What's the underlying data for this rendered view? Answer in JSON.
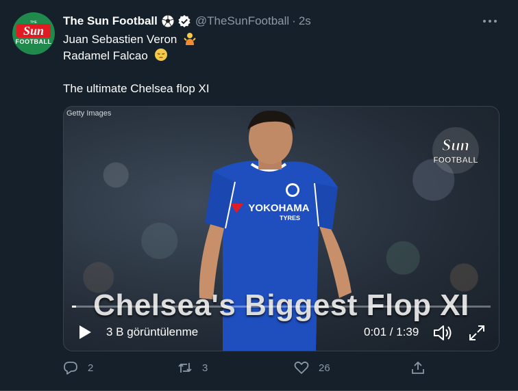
{
  "tweet": {
    "account": {
      "display_name": "The Sun Football",
      "handle": "@TheSunFootball",
      "separator": "·",
      "time": "2s",
      "avatar_logo": {
        "the": "THE",
        "sun": "Sun",
        "football": "FOOTBALL"
      }
    },
    "text_lines": [
      "Juan Sebastien Veron",
      "Radamel Falcao",
      "",
      "The ultimate Chelsea flop XI"
    ],
    "media": {
      "credit": "Getty Images",
      "watermark": {
        "sun": "Sun",
        "football": "FOOTBALL"
      },
      "overlay_title": "Chelsea's Biggest Flop XI",
      "shirt_sponsor": "YOKOHAMA",
      "shirt_sponsor_sub": "TYRES",
      "views_label": "3 B görüntülenme",
      "timecode": "0:01 / 1:39",
      "progress_fraction": 0.01
    },
    "actions": {
      "reply_count": "2",
      "retweet_count": "3",
      "like_count": "26"
    }
  },
  "colors": {
    "background": "#15202b",
    "secondary_text": "#8b98a5",
    "border": "#38444d",
    "sun_red": "#e01b22",
    "avatar_green": "#1f8a4c",
    "chelsea_blue": "#1f4fbf"
  },
  "icons": {
    "header": [
      "soccer-ball-icon",
      "verified-badge-icon",
      "more-options-icon"
    ],
    "emoji": [
      "person-shrugging-emoji",
      "pensive-face-emoji"
    ],
    "player_controls": [
      "play-icon",
      "volume-icon",
      "fullscreen-icon"
    ],
    "actions": [
      "reply-icon",
      "retweet-icon",
      "like-icon",
      "share-icon"
    ]
  }
}
